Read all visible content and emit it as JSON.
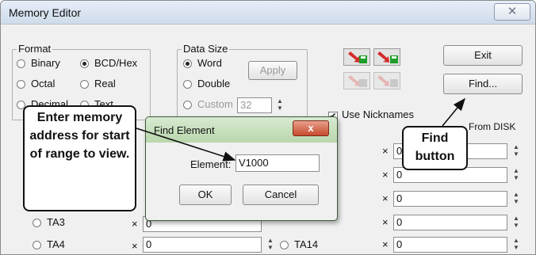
{
  "window": {
    "title": "Memory Editor",
    "close_glyph": "✕"
  },
  "format": {
    "title": "Format",
    "options": [
      "Binary",
      "BCD/Hex",
      "Octal",
      "Real",
      "Decimal",
      "Text"
    ],
    "selected": "BCD/Hex"
  },
  "data_size": {
    "title": "Data Size",
    "options": [
      "Word",
      "Double",
      "Custom"
    ],
    "selected": "Word",
    "custom_value": "32",
    "apply_label": "Apply"
  },
  "toolbar": {
    "exit_label": "Exit",
    "find_label": "Find...",
    "use_nicknames_label": "Use Nicknames",
    "use_nicknames_checked": true,
    "from_disk_label": "From DISK"
  },
  "rows_left": [
    {
      "label": "TA3",
      "value": "0"
    },
    {
      "label": "TA4",
      "value": "0"
    }
  ],
  "row_right_label": "TA14",
  "right_values": [
    "0",
    "0",
    "0",
    "0",
    "0"
  ],
  "x_glyph": "×",
  "find_element_dialog": {
    "title": "Find Element",
    "element_label": "Element:",
    "element_value": "V1000",
    "ok_label": "OK",
    "cancel_label": "Cancel",
    "close_glyph": "x"
  },
  "callouts": {
    "enter_memory": "Enter memory address for start of range to view.",
    "find_button": "Find button"
  },
  "colors": {
    "icon_green": "#1f9d2a",
    "icon_red": "#d42a2a",
    "dialog_title": "#c3dfb6"
  }
}
